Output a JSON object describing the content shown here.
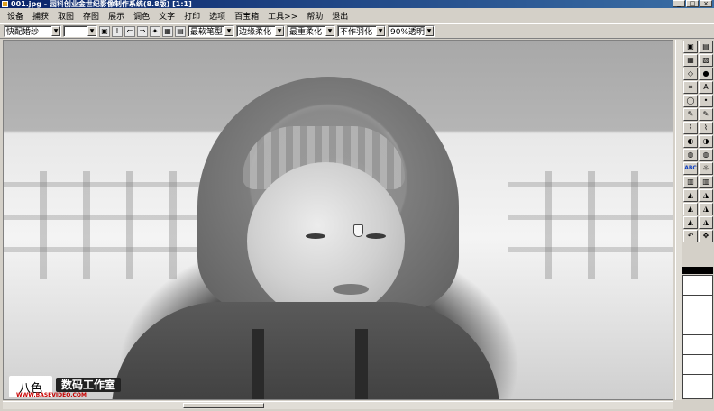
{
  "window": {
    "title": "001.jpg - 园科创业金世纪影像制作系统(8.8版) [1:1]",
    "buttons": [
      "_",
      "□",
      "×"
    ]
  },
  "menu": [
    "设备",
    "捕获",
    "取图",
    "存图",
    "展示",
    "调色",
    "文字",
    "打印",
    "选项",
    "百宝箱",
    "工具>>",
    "帮助",
    "退出"
  ],
  "toolbar": {
    "preset": "快配婚纱",
    "blank_combo": "",
    "brush_shape": "最软笔型",
    "edge_soft": "边缘柔化",
    "heavy_soft": "最重柔化",
    "feather": "不作羽化",
    "opacity": "90%透明"
  },
  "toolpanel": {
    "tools": [
      "▣",
      "▤",
      "▦",
      "▧",
      "◇",
      "●",
      "⌗",
      "A",
      "◯",
      "•",
      "✎",
      "✎",
      "⌇",
      "⌇",
      "◐",
      "◑",
      "◍",
      "◍",
      "ABC",
      "☼",
      "▥",
      "▥",
      "◭",
      "◮",
      "◭",
      "◮",
      "◭",
      "◮",
      "↶",
      "✥"
    ]
  },
  "watermark": {
    "logo": "八色",
    "badge": "数码工作室",
    "url": "WWW.BASEVIDEO.COM"
  }
}
